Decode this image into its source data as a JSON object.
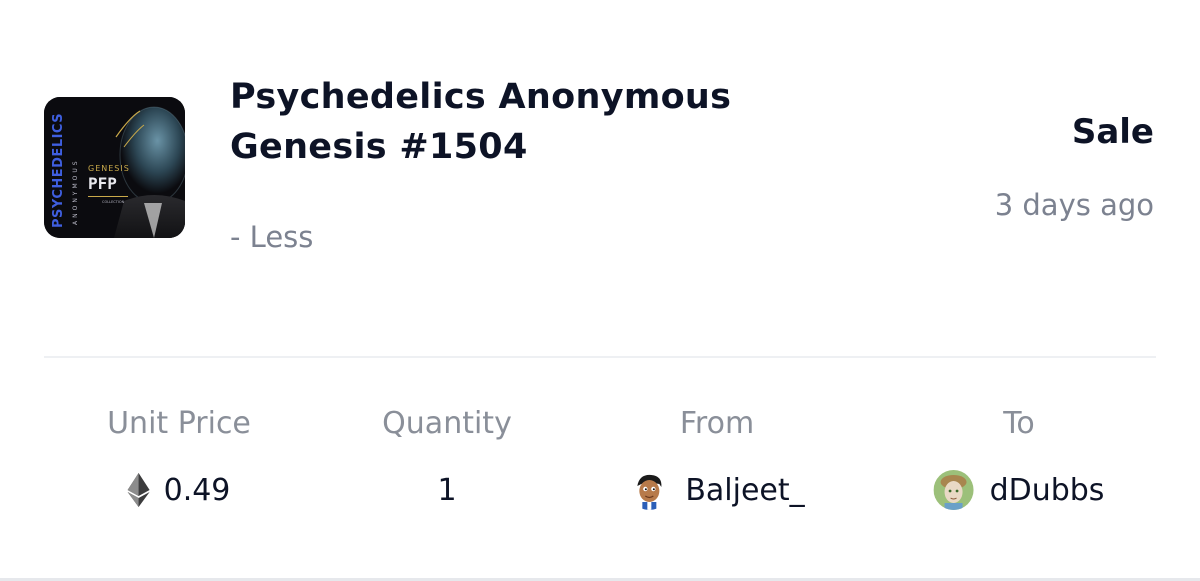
{
  "item": {
    "title_line1": "Psychedelics Anonymous",
    "title_line2": "Genesis #1504",
    "toggle_label": "- Less",
    "thumbnail": {
      "vertical_text": "PSYCHEDELICS",
      "vertical_subtext": "ANONYMOUS",
      "badge_top": "GENESIS",
      "badge_main": "PFP",
      "badge_small": "COLLECTION"
    }
  },
  "event": {
    "type": "Sale",
    "time": "3 days ago"
  },
  "stats": {
    "unit_price_label": "Unit Price",
    "unit_price_value": "0.49",
    "currency_icon": "ethereum-icon",
    "quantity_label": "Quantity",
    "quantity_value": "1",
    "from_label": "From",
    "from_user": "Baljeet_",
    "to_label": "To",
    "to_user": "dDubbs"
  },
  "colors": {
    "title": "#0d1326",
    "muted": "#7c8290",
    "label": "#8a8f99",
    "divider": "#eef0f3",
    "thumb_accent": "#3f5fe0",
    "thumb_gold": "#c9a94a"
  }
}
